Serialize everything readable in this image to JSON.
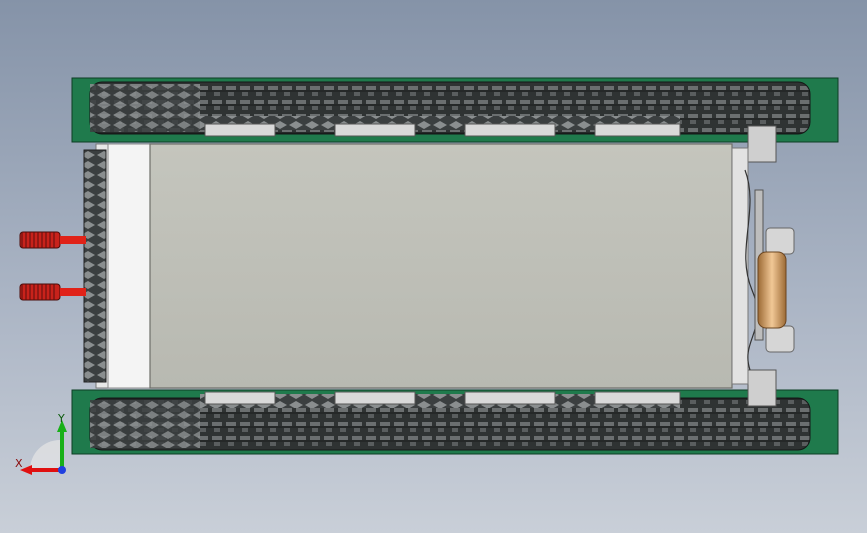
{
  "view": {
    "background_top": "#8593a8",
    "background_bottom": "#c9cfd8"
  },
  "model": {
    "frame_color": "#1f7a4c",
    "track_color": "#3a3d3d",
    "plate_color": "#bfc0b8",
    "steel_color": "#dcdcdc",
    "red_part_color": "#d0201a",
    "roller_color": "#d8a56a"
  },
  "triad": {
    "x_label": "X",
    "y_label": "Y",
    "x_color": "#e01010",
    "y_color": "#18b018",
    "z_color": "#2040e0"
  }
}
